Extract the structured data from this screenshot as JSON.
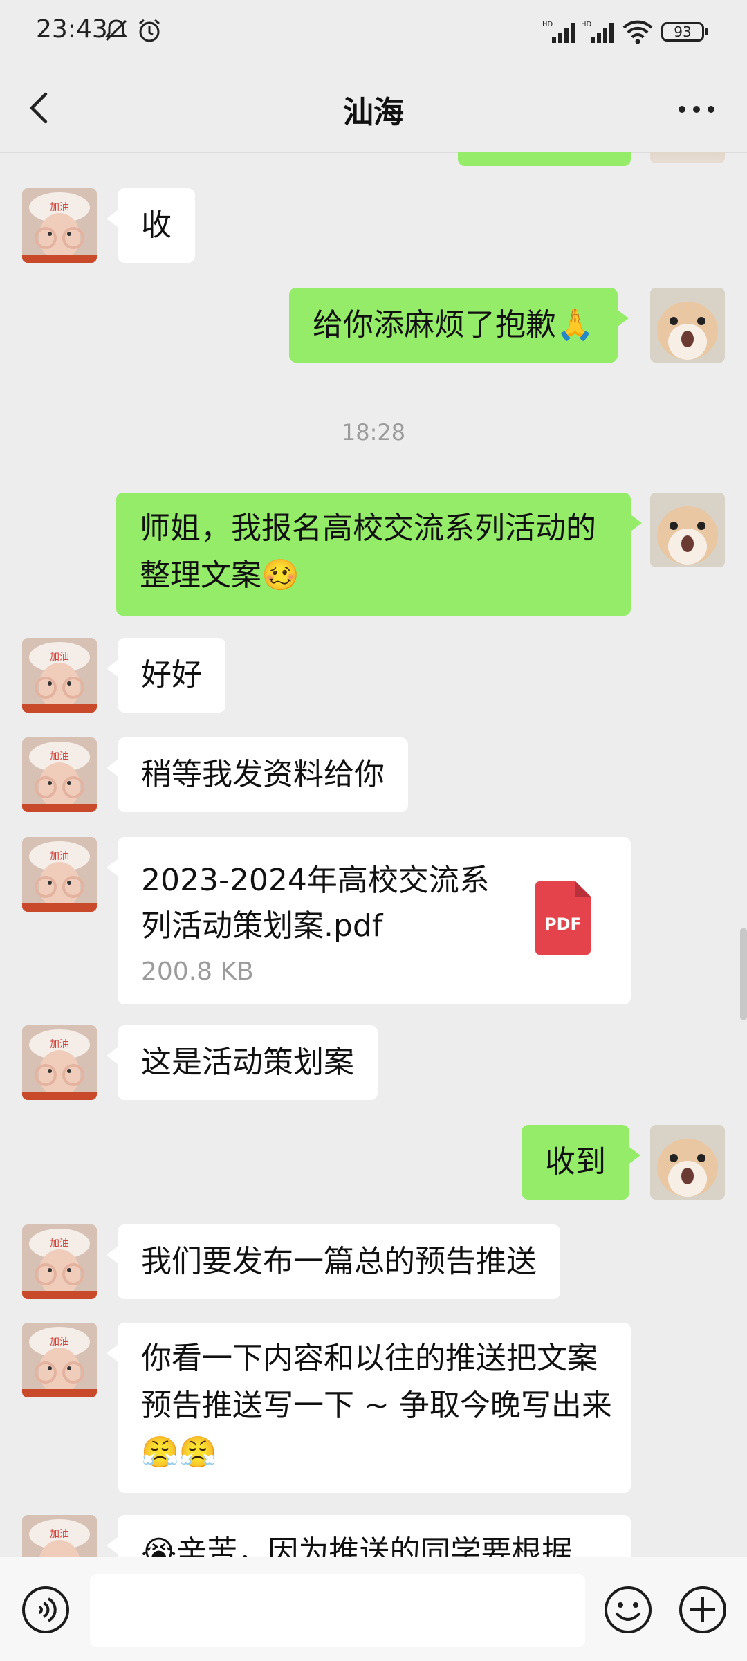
{
  "status_bar": {
    "time": "23:43",
    "battery": "93",
    "signal_1": "HD",
    "signal_2": "HD"
  },
  "header": {
    "title": "汕海"
  },
  "messages": [
    {
      "text": "收"
    },
    {
      "text": "给你添麻烦了抱歉🙏"
    },
    {
      "text": "18:28"
    },
    {
      "text_line1": "师姐，我报名高校交流系列活动的",
      "text_line2": "整理文案🥴"
    },
    {
      "text": "好好"
    },
    {
      "text": "稍等我发资料给你"
    },
    {
      "file_name": "2023-2024年高校交流系列活动策划案.pdf",
      "file_size": "200.8 KB",
      "file_icon_label": "PDF"
    },
    {
      "text": "这是活动策划案"
    },
    {
      "text": "收到"
    },
    {
      "text": "我们要发布一篇总的预告推送"
    },
    {
      "text_line1": "你看一下内容和以往的推送把文案",
      "text_line2": "预告推送写一下 ~ 争取今晚写出来",
      "text_line3": "😤😤"
    },
    {
      "text": "😭辛苦，因为推送的同学要根据"
    }
  ],
  "input": {
    "placeholder": ""
  },
  "colors": {
    "incoming_bubble": "#FFFFFF",
    "outgoing_bubble": "#95EC69",
    "background": "#EDEDED",
    "pdf_red": "#E5434B"
  }
}
